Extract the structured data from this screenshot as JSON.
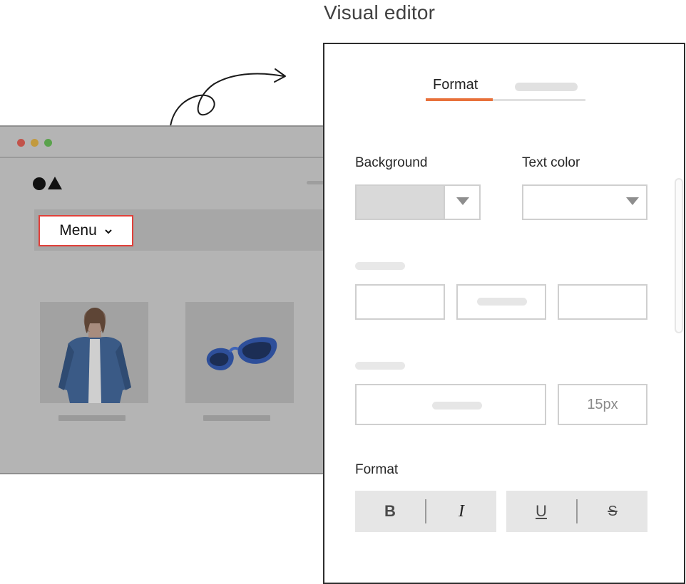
{
  "heading": "Visual editor",
  "website": {
    "menu_label": "Menu",
    "menu_chevron": "⌄",
    "products": [
      {
        "icon": "denim-jacket-photo"
      },
      {
        "icon": "sunglasses-photo"
      }
    ]
  },
  "editor": {
    "tabs": [
      {
        "label": "Format",
        "active": true
      }
    ],
    "background_label": "Background",
    "text_color_label": "Text color",
    "size_value": "15px",
    "format_label": "Format",
    "format_buttons": {
      "bold": "B",
      "italic": "I",
      "underline": "U",
      "strike": "S"
    }
  },
  "colors": {
    "accent": "#e8703a",
    "highlight": "#e0403a"
  }
}
